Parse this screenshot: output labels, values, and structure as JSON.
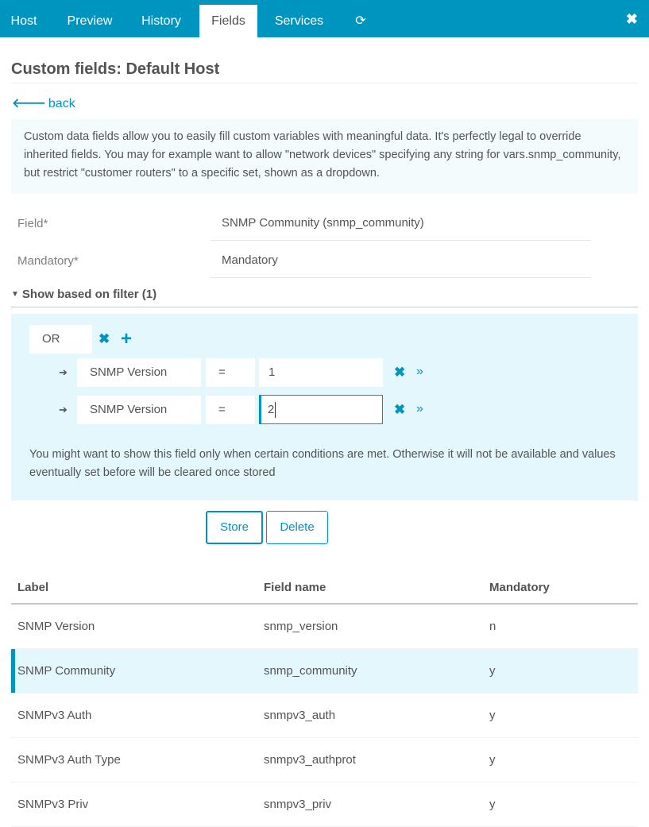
{
  "tabs": [
    {
      "label": "Host",
      "active": false
    },
    {
      "label": "Preview",
      "active": false
    },
    {
      "label": "History",
      "active": false
    },
    {
      "label": "Fields",
      "active": true
    },
    {
      "label": "Services",
      "active": false
    }
  ],
  "refresh_icon": "⟳",
  "close_icon": "✖",
  "page_title": "Custom fields: Default Host",
  "back": {
    "icon": "🡐",
    "label": "back"
  },
  "hint": "Custom data fields allow you to easily fill custom variables with meaningful data. It's perfectly legal to override inherited fields. You may for example want to allow \"network devices\" specifying any string for vars.snmp_community, but restrict \"customer routers\" to a specific set, shown as a dropdown.",
  "form": {
    "field": {
      "label": "Field*",
      "value": "SNMP Community (snmp_community)"
    },
    "mandatory": {
      "label": "Mandatory*",
      "value": "Mandatory"
    }
  },
  "filter": {
    "toggle_label": "Show based on filter (1)",
    "operator": "OR",
    "conditions": [
      {
        "column": "SNMP Version",
        "op": "=",
        "value": "1"
      },
      {
        "column": "SNMP Version",
        "op": "=",
        "value": "2"
      }
    ],
    "description": "You might want to show this field only when certain conditions are met. Otherwise it will not be available and values eventually set before will be cleared once stored"
  },
  "buttons": {
    "store": "Store",
    "delete": "Delete"
  },
  "table": {
    "headers": [
      "Label",
      "Field name",
      "Mandatory"
    ],
    "rows": [
      [
        "SNMP Version",
        "snmp_version",
        "n"
      ],
      [
        "SNMP Community",
        "snmp_community",
        "y"
      ],
      [
        "SNMPv3 Auth",
        "snmpv3_auth",
        "y"
      ],
      [
        "SNMPv3 Auth Type",
        "snmpv3_authprot",
        "y"
      ],
      [
        "SNMPv3 Priv",
        "snmpv3_priv",
        "y"
      ]
    ],
    "selected_index": 1
  },
  "colors": {
    "accent": "#0095bf",
    "hint_bg": "#f3fbfd",
    "filter_bg": "#e4f7fd"
  }
}
